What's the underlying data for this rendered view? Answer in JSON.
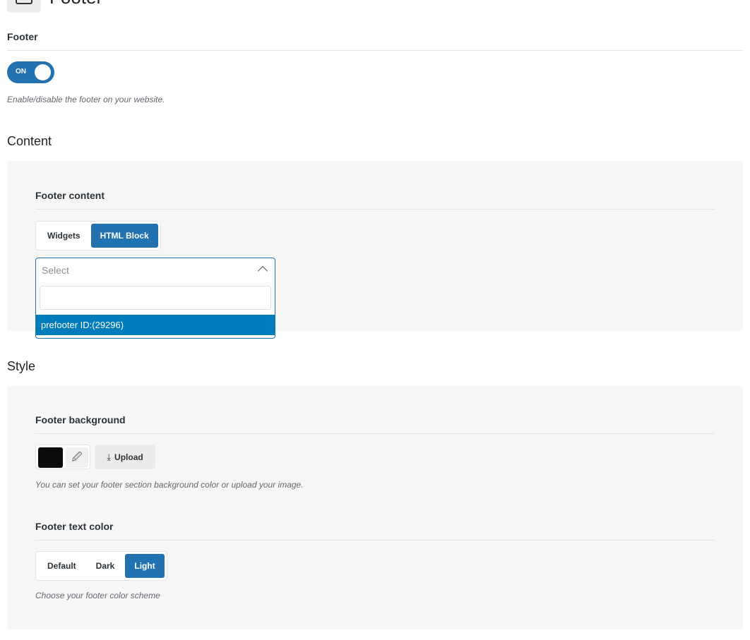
{
  "page": {
    "title": "Footer",
    "icon": "footer-layout-icon"
  },
  "footer_toggle": {
    "label": "Footer",
    "state_text": "ON",
    "description": "Enable/disable the footer on your website."
  },
  "content_section": {
    "title": "Content",
    "footer_content": {
      "label": "Footer content",
      "options": [
        "Widgets",
        "HTML Block"
      ],
      "selected": "HTML Block",
      "select": {
        "placeholder": "Select",
        "search_value": "",
        "highlighted_option": "prefooter ID:(29296)"
      }
    }
  },
  "style_section": {
    "title": "Style",
    "footer_background": {
      "label": "Footer background",
      "color": "#0b0b0b",
      "upload_label": "Upload",
      "description": "You can set your footer section background color or upload your image."
    },
    "footer_text_color": {
      "label": "Footer text color",
      "options": [
        "Default",
        "Dark",
        "Light"
      ],
      "selected": "Light",
      "description": "Choose your footer color scheme"
    }
  },
  "colors": {
    "accent": "#2271b1",
    "option_highlight": "#007cba",
    "panel_bg": "#f6f6f6"
  }
}
